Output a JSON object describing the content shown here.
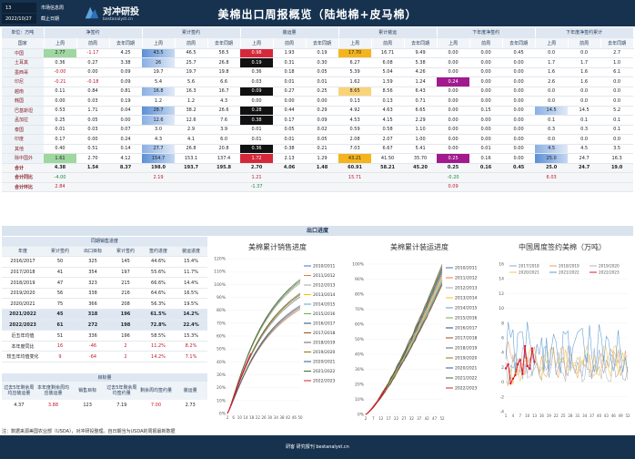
{
  "header": {
    "cell_top_left": "13",
    "cell_top_right": "市场信息周",
    "cell_bottom_left": "2022/10/27",
    "cell_bottom_right": "截止日期",
    "logo_cn": "对冲研投",
    "logo_en": "bestanalyst.cn",
    "title": "美棉出口周报概览（陆地棉+皮马棉）"
  },
  "colors": {
    "header_bg": "#16324f",
    "accent_red": "#c0182c",
    "accent_green": "#1a8a3a",
    "section_bg": "#dfe8f2"
  },
  "table": {
    "unit_label": "单位：万吨",
    "groups": [
      "净签约",
      "累计签约",
      "装运量",
      "累计装运",
      "下年度净签约",
      "下年度净签约累计"
    ],
    "country_header": "国家",
    "sub_headers": [
      "上周",
      "前周",
      "去年同期"
    ],
    "rows": [
      {
        "country": "中国",
        "v": [
          "2.77",
          "-1.17",
          "4.25",
          "43.5",
          "46.5",
          "58.5",
          "0.98",
          "1.93",
          "0.19",
          "17.70",
          "16.71",
          "9.49",
          "0.00",
          "0.00",
          "0.45",
          "0.0",
          "0.0",
          "2.7"
        ]
      },
      {
        "country": "土耳其",
        "v": [
          "0.36",
          "0.27",
          "3.38",
          "26",
          "25.7",
          "26.8",
          "0.19",
          "0.31",
          "0.30",
          "6.27",
          "6.08",
          "5.38",
          "0.00",
          "0.00",
          "0.00",
          "1.7",
          "1.7",
          "1.0"
        ]
      },
      {
        "country": "墨西哥",
        "v": [
          "-0.00",
          "0.00",
          "0.09",
          "19.7",
          "19.7",
          "19.8",
          "0.36",
          "0.18",
          "0.05",
          "5.39",
          "5.04",
          "4.26",
          "0.00",
          "0.00",
          "0.00",
          "1.6",
          "1.6",
          "6.1"
        ]
      },
      {
        "country": "印尼",
        "v": [
          "-0.21",
          "-0.18",
          "0.09",
          "5.4",
          "5.6",
          "6.6",
          "0.03",
          "0.01",
          "0.01",
          "1.62",
          "1.59",
          "1.24",
          "0.24",
          "0.00",
          "0.00",
          "2.6",
          "1.6",
          "0.0"
        ]
      },
      {
        "country": "越南",
        "v": [
          "0.11",
          "0.84",
          "0.81",
          "16.8",
          "16.3",
          "16.7",
          "0.09",
          "0.27",
          "0.25",
          "8.65",
          "8.56",
          "6.43",
          "0.00",
          "0.00",
          "0.00",
          "0.0",
          "0.0",
          "0.0"
        ]
      },
      {
        "country": "韩国",
        "v": [
          "0.00",
          "0.03",
          "0.19",
          "1.2",
          "1.2",
          "4.3",
          "0.00",
          "0.00",
          "0.00",
          "0.13",
          "0.13",
          "0.71",
          "0.00",
          "0.00",
          "0.00",
          "0.0",
          "0.0",
          "0.0"
        ]
      },
      {
        "country": "巴基斯坦",
        "v": [
          "0.53",
          "1.71",
          "0.04",
          "28.7",
          "38.2",
          "26.6",
          "0.28",
          "0.44",
          "0.29",
          "4.92",
          "4.63",
          "6.65",
          "0.00",
          "0.15",
          "0.00",
          "14.5",
          "14.5",
          "5.2"
        ]
      },
      {
        "country": "孟加拉",
        "v": [
          "0.25",
          "0.05",
          "0.00",
          "12.6",
          "12.6",
          "7.6",
          "0.38",
          "0.17",
          "0.09",
          "4.53",
          "4.15",
          "2.29",
          "0.00",
          "0.00",
          "0.00",
          "0.1",
          "0.1",
          "0.1"
        ]
      },
      {
        "country": "泰国",
        "v": [
          "0.01",
          "0.03",
          "0.07",
          "3.0",
          "2.9",
          "3.9",
          "0.01",
          "0.05",
          "0.02",
          "0.59",
          "0.58",
          "1.10",
          "0.00",
          "0.00",
          "0.00",
          "0.3",
          "0.3",
          "0.1"
        ]
      },
      {
        "country": "印度",
        "v": [
          "0.17",
          "0.00",
          "0.24",
          "4.3",
          "4.1",
          "6.0",
          "0.01",
          "0.01",
          "0.05",
          "2.08",
          "2.07",
          "1.00",
          "0.00",
          "0.00",
          "0.00",
          "0.0",
          "0.0",
          "0.0"
        ]
      },
      {
        "country": "其他",
        "v": [
          "0.40",
          "0.51",
          "0.14",
          "27.7",
          "26.8",
          "20.8",
          "0.36",
          "0.38",
          "0.21",
          "7.03",
          "6.67",
          "5.41",
          "0.00",
          "0.01",
          "0.00",
          "4.5",
          "4.5",
          "3.5"
        ]
      },
      {
        "country": "除中国外",
        "v": [
          "1.61",
          "2.70",
          "4.12",
          "154.7",
          "153.1",
          "137.4",
          "1.72",
          "2.13",
          "1.29",
          "43.21",
          "41.50",
          "35.70",
          "0.25",
          "0.16",
          "0.00",
          "25.0",
          "24.7",
          "16.3"
        ]
      }
    ],
    "total_label": "合计",
    "total": [
      "4.38",
      "1.54",
      "8.37",
      "198.0",
      "193.7",
      "195.8",
      "2.70",
      "4.06",
      "1.48",
      "60.91",
      "58.21",
      "45.20",
      "0.25",
      "0.16",
      "0.45",
      "25.0",
      "24.7",
      "19.0"
    ],
    "yoy_label": "合计同比",
    "yoy": [
      "-4.00",
      "",
      "",
      "2.19",
      "",
      "",
      "1.21",
      "",
      "",
      "15.71",
      "",
      "",
      "-0.20",
      "",
      "",
      "6.03",
      "",
      ""
    ],
    "mom_label": "合计环比",
    "mom": [
      "2.84",
      "",
      "",
      "",
      "",
      "",
      "-1.37",
      "",
      "",
      "",
      "",
      "",
      "0.09",
      "",
      "",
      "",
      "",
      ""
    ]
  },
  "section_title": "出口进度",
  "progress": {
    "caption": "同期销售进度",
    "headers": [
      "年度",
      "累计签约",
      "出口目标",
      "累计签约",
      "签约进度",
      "装运进度"
    ],
    "rows": [
      {
        "label": "2016/2017",
        "v": [
          "50",
          "325",
          "145",
          "44.6%",
          "15.4%"
        ]
      },
      {
        "label": "2017/2018",
        "v": [
          "41",
          "354",
          "197",
          "55.6%",
          "11.7%"
        ]
      },
      {
        "label": "2018/2019",
        "v": [
          "47",
          "323",
          "215",
          "66.6%",
          "14.4%"
        ]
      },
      {
        "label": "2019/2020",
        "v": [
          "56",
          "338",
          "216",
          "64.6%",
          "16.5%"
        ]
      },
      {
        "label": "2020/2021",
        "v": [
          "75",
          "366",
          "208",
          "56.3%",
          "19.5%"
        ]
      },
      {
        "label": "2021/2022",
        "v": [
          "45",
          "318",
          "196",
          "61.5%",
          "14.2%"
        ],
        "hl": true
      },
      {
        "label": "2022/2023",
        "v": [
          "61",
          "272",
          "198",
          "72.8%",
          "22.4%"
        ],
        "hl": true
      },
      {
        "label": "近五年均值",
        "v": [
          "51",
          "336",
          "196",
          "58.5%",
          "15.3%"
        ]
      },
      {
        "label": "本年度同比",
        "v": [
          "16",
          "-46",
          "2",
          "11.2%",
          "8.2%"
        ],
        "neg": true
      },
      {
        "label": "较五年均值变化",
        "v": [
          "9",
          "-64",
          "2",
          "14.2%",
          "7.1%"
        ],
        "neg": true
      }
    ]
  },
  "target": {
    "caption": "目标量",
    "headers": [
      "过去5年剩余周均应装运量",
      "本年度剩余周均应装运量",
      "销售目标",
      "过去5年剩余周均签约量",
      "剩余周均签约量",
      "装运量"
    ],
    "values": [
      "4.37",
      "3.88",
      "123",
      "7.19",
      "7.00",
      "2.73"
    ]
  },
  "chart1": {
    "title": "美棉累计销售进度",
    "y_ticks": [
      "120%",
      "110%",
      "100%",
      "90%",
      "80%",
      "70%",
      "60%",
      "50%",
      "40%",
      "30%",
      "20%",
      "10%",
      "0%"
    ],
    "x_ticks": [
      "2",
      "6",
      "10",
      "14",
      "18",
      "22",
      "26",
      "30",
      "34",
      "38",
      "42",
      "46",
      "50"
    ],
    "legend": [
      "2010/2011",
      "2011/2012",
      "2012/2013",
      "2013/2014",
      "2014/2015",
      "2015/2016",
      "2016/2017",
      "2017/2018",
      "2018/2019",
      "2019/2020",
      "2020/2021",
      "2021/2022",
      "2022/2023"
    ],
    "colors": [
      "#4472c4",
      "#ed7d31",
      "#a5a5a5",
      "#ffc000",
      "#5b9bd5",
      "#70ad47",
      "#264478",
      "#9e480e",
      "#636363",
      "#997300",
      "#255e91",
      "#43682b",
      "#e0192b"
    ]
  },
  "chart2": {
    "title": "美棉累计装运进度",
    "y_ticks": [
      "100%",
      "90%",
      "80%",
      "70%",
      "60%",
      "50%",
      "40%",
      "30%",
      "20%",
      "10%",
      "0%"
    ],
    "x_ticks": [
      "2",
      "7",
      "12",
      "17",
      "22",
      "27",
      "32",
      "37",
      "42",
      "47",
      "52"
    ],
    "legend": [
      "2010/2011",
      "2011/2012",
      "2012/2013",
      "2013/2014",
      "2014/2015",
      "2015/2016",
      "2016/2017",
      "2017/2018",
      "2018/2019",
      "2019/2020",
      "2020/2021",
      "2021/2022",
      "2022/2023"
    ]
  },
  "chart3": {
    "title": "中国周度签约美棉（万吨）",
    "legend": [
      "2017/2018",
      "2018/2019",
      "2019/2020",
      "2020/2021",
      "2021/2022",
      "2022/2023"
    ],
    "colors": [
      "#8aa8d6",
      "#e9a266",
      "#b4b4b4",
      "#f2c94c",
      "#5b9bd5",
      "#e0192b"
    ],
    "y_ticks": [
      "16",
      "14",
      "12",
      "10",
      "8",
      "6",
      "4",
      "2",
      "0",
      "-2",
      "-4"
    ],
    "x_ticks": [
      "1",
      "4",
      "7",
      "10",
      "13",
      "16",
      "19",
      "22",
      "25",
      "28",
      "31",
      "34",
      "37",
      "40",
      "43",
      "46",
      "49",
      "52"
    ]
  },
  "footer_note": "注：数据来源美国农业部（USDA），对冲研投整理。自日期当为USDA的周报最新数据",
  "footer_text": "研客 研究报刊  bestanalyst.cn",
  "watermark": "对冲研投"
}
